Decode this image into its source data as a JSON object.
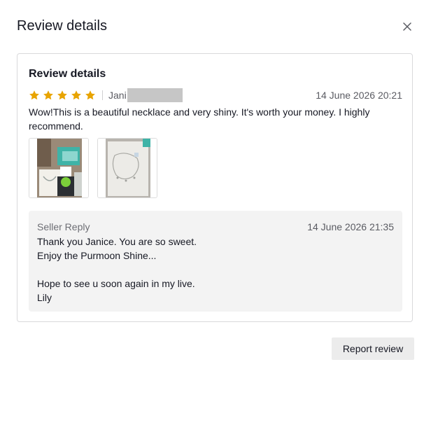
{
  "modal": {
    "title": "Review details",
    "close_icon": "close-icon"
  },
  "review": {
    "card_title": "Review details",
    "rating": 5,
    "rating_max": 5,
    "star_color": "#e8a400",
    "reviewer_visible": "Jani",
    "date": "14 June 2026 20:21",
    "text": "Wow!This is a beautiful necklace and very shiny. It's worth your money. I highly recommend.",
    "photo_count": 2
  },
  "reply": {
    "label": "Seller Reply",
    "date": "14 June 2026 21:35",
    "lines": [
      "Thank you Janice. You are so sweet.",
      "Enjoy the Purmoon Shine...",
      "",
      "Hope to see u soon again in my live.",
      "Lily"
    ]
  },
  "actions": {
    "report_label": "Report review"
  }
}
